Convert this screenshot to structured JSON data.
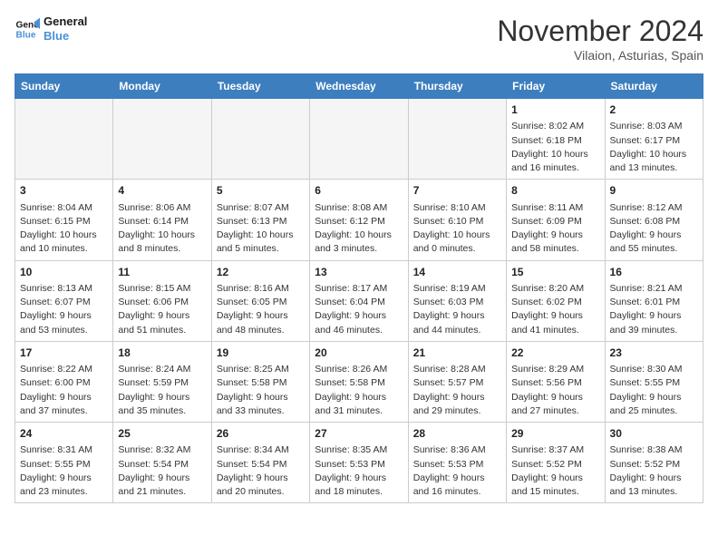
{
  "header": {
    "logo_line1": "General",
    "logo_line2": "Blue",
    "month": "November 2024",
    "location": "Vilaion, Asturias, Spain"
  },
  "days_of_week": [
    "Sunday",
    "Monday",
    "Tuesday",
    "Wednesday",
    "Thursday",
    "Friday",
    "Saturday"
  ],
  "weeks": [
    [
      {
        "day": "",
        "content": ""
      },
      {
        "day": "",
        "content": ""
      },
      {
        "day": "",
        "content": ""
      },
      {
        "day": "",
        "content": ""
      },
      {
        "day": "",
        "content": ""
      },
      {
        "day": "1",
        "content": "Sunrise: 8:02 AM\nSunset: 6:18 PM\nDaylight: 10 hours\nand 16 minutes."
      },
      {
        "day": "2",
        "content": "Sunrise: 8:03 AM\nSunset: 6:17 PM\nDaylight: 10 hours\nand 13 minutes."
      }
    ],
    [
      {
        "day": "3",
        "content": "Sunrise: 8:04 AM\nSunset: 6:15 PM\nDaylight: 10 hours\nand 10 minutes."
      },
      {
        "day": "4",
        "content": "Sunrise: 8:06 AM\nSunset: 6:14 PM\nDaylight: 10 hours\nand 8 minutes."
      },
      {
        "day": "5",
        "content": "Sunrise: 8:07 AM\nSunset: 6:13 PM\nDaylight: 10 hours\nand 5 minutes."
      },
      {
        "day": "6",
        "content": "Sunrise: 8:08 AM\nSunset: 6:12 PM\nDaylight: 10 hours\nand 3 minutes."
      },
      {
        "day": "7",
        "content": "Sunrise: 8:10 AM\nSunset: 6:10 PM\nDaylight: 10 hours\nand 0 minutes."
      },
      {
        "day": "8",
        "content": "Sunrise: 8:11 AM\nSunset: 6:09 PM\nDaylight: 9 hours\nand 58 minutes."
      },
      {
        "day": "9",
        "content": "Sunrise: 8:12 AM\nSunset: 6:08 PM\nDaylight: 9 hours\nand 55 minutes."
      }
    ],
    [
      {
        "day": "10",
        "content": "Sunrise: 8:13 AM\nSunset: 6:07 PM\nDaylight: 9 hours\nand 53 minutes."
      },
      {
        "day": "11",
        "content": "Sunrise: 8:15 AM\nSunset: 6:06 PM\nDaylight: 9 hours\nand 51 minutes."
      },
      {
        "day": "12",
        "content": "Sunrise: 8:16 AM\nSunset: 6:05 PM\nDaylight: 9 hours\nand 48 minutes."
      },
      {
        "day": "13",
        "content": "Sunrise: 8:17 AM\nSunset: 6:04 PM\nDaylight: 9 hours\nand 46 minutes."
      },
      {
        "day": "14",
        "content": "Sunrise: 8:19 AM\nSunset: 6:03 PM\nDaylight: 9 hours\nand 44 minutes."
      },
      {
        "day": "15",
        "content": "Sunrise: 8:20 AM\nSunset: 6:02 PM\nDaylight: 9 hours\nand 41 minutes."
      },
      {
        "day": "16",
        "content": "Sunrise: 8:21 AM\nSunset: 6:01 PM\nDaylight: 9 hours\nand 39 minutes."
      }
    ],
    [
      {
        "day": "17",
        "content": "Sunrise: 8:22 AM\nSunset: 6:00 PM\nDaylight: 9 hours\nand 37 minutes."
      },
      {
        "day": "18",
        "content": "Sunrise: 8:24 AM\nSunset: 5:59 PM\nDaylight: 9 hours\nand 35 minutes."
      },
      {
        "day": "19",
        "content": "Sunrise: 8:25 AM\nSunset: 5:58 PM\nDaylight: 9 hours\nand 33 minutes."
      },
      {
        "day": "20",
        "content": "Sunrise: 8:26 AM\nSunset: 5:58 PM\nDaylight: 9 hours\nand 31 minutes."
      },
      {
        "day": "21",
        "content": "Sunrise: 8:28 AM\nSunset: 5:57 PM\nDaylight: 9 hours\nand 29 minutes."
      },
      {
        "day": "22",
        "content": "Sunrise: 8:29 AM\nSunset: 5:56 PM\nDaylight: 9 hours\nand 27 minutes."
      },
      {
        "day": "23",
        "content": "Sunrise: 8:30 AM\nSunset: 5:55 PM\nDaylight: 9 hours\nand 25 minutes."
      }
    ],
    [
      {
        "day": "24",
        "content": "Sunrise: 8:31 AM\nSunset: 5:55 PM\nDaylight: 9 hours\nand 23 minutes."
      },
      {
        "day": "25",
        "content": "Sunrise: 8:32 AM\nSunset: 5:54 PM\nDaylight: 9 hours\nand 21 minutes."
      },
      {
        "day": "26",
        "content": "Sunrise: 8:34 AM\nSunset: 5:54 PM\nDaylight: 9 hours\nand 20 minutes."
      },
      {
        "day": "27",
        "content": "Sunrise: 8:35 AM\nSunset: 5:53 PM\nDaylight: 9 hours\nand 18 minutes."
      },
      {
        "day": "28",
        "content": "Sunrise: 8:36 AM\nSunset: 5:53 PM\nDaylight: 9 hours\nand 16 minutes."
      },
      {
        "day": "29",
        "content": "Sunrise: 8:37 AM\nSunset: 5:52 PM\nDaylight: 9 hours\nand 15 minutes."
      },
      {
        "day": "30",
        "content": "Sunrise: 8:38 AM\nSunset: 5:52 PM\nDaylight: 9 hours\nand 13 minutes."
      }
    ]
  ]
}
